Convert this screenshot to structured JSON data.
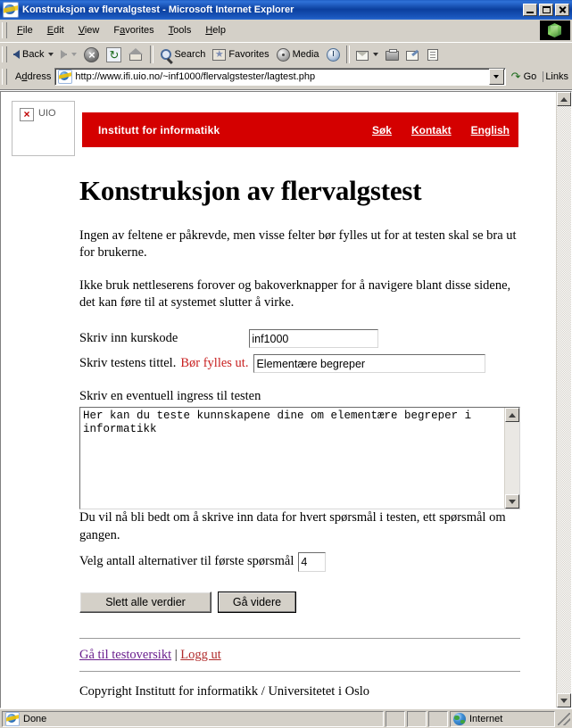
{
  "window": {
    "title": "Konstruksjon av flervalgstest - Microsoft Internet Explorer",
    "minimize_label": "Minimize",
    "maximize_label": "Maximize",
    "close_label": "Close"
  },
  "menubar": {
    "items": [
      {
        "label": "File"
      },
      {
        "label": "Edit"
      },
      {
        "label": "View"
      },
      {
        "label": "Favorites"
      },
      {
        "label": "Tools"
      },
      {
        "label": "Help"
      }
    ]
  },
  "toolbar": {
    "back_label": "Back",
    "forward_label": "",
    "search_label": "Search",
    "favorites_label": "Favorites",
    "media_label": "Media",
    "icons": [
      "back-icon",
      "forward-icon",
      "stop-icon",
      "refresh-icon",
      "home-icon",
      "search-icon",
      "favorites-icon",
      "media-icon",
      "history-icon",
      "mail-icon",
      "print-icon",
      "edit-icon",
      "discuss-icon"
    ]
  },
  "addressbar": {
    "label": "Address",
    "url": "http://www.ifi.uio.no/~inf1000/flervalgstester/lagtest.php",
    "placeholder": "Address",
    "go_label": "Go",
    "links_label": "Links"
  },
  "page": {
    "logo": {
      "alt_text": "UIO"
    },
    "banner": {
      "title": "Institutt for informatikk",
      "links": [
        {
          "label": "Søk"
        },
        {
          "label": "Kontakt"
        },
        {
          "label": "English"
        }
      ],
      "color": "#d40000"
    },
    "heading": "Konstruksjon av flervalgstest",
    "paragraphs": [
      "Ingen av feltene er påkrevde, men visse felter bør fylles ut for at testen skal se bra ut for brukerne.",
      "Ikke bruk nettleserens forover og bakoverknapper for å navigere blant disse sidene, det kan føre til at systemet slutter å virke."
    ],
    "form": {
      "kurskode": {
        "label": "Skriv inn kurskode",
        "value": "inf1000",
        "placeholder": ""
      },
      "tittel": {
        "label": "Skriv testens tittel.",
        "warning": "Bør fylles ut.",
        "warning_color": "#c82020",
        "value": "Elementære begreper",
        "placeholder": ""
      },
      "ingress": {
        "label": "Skriv en eventuell ingress til testen",
        "value": "Her kan du teste kunnskapene dine om elementære begreper i informatikk",
        "placeholder": ""
      },
      "antall": {
        "label": "Velg antall alternativer til første spørsmål",
        "value": "4",
        "placeholder": ""
      },
      "info_text": "Du vil nå bli bedt om å skrive inn data for hvert spørsmål i testen, ett spørsmål om gangen.",
      "reset_button": "Slett alle verdier",
      "submit_button": "Gå videre"
    },
    "footer": {
      "link_overview": "Gå til testoversikt",
      "separator": "|",
      "link_logout": "Logg ut",
      "copyright": "Copyright Institutt for informatikk / Universitetet i Oslo",
      "visited_link_color": "#6a1f8e",
      "link_color": "#b02a2a"
    }
  },
  "statusbar": {
    "status": "Done",
    "zone": "Internet"
  }
}
